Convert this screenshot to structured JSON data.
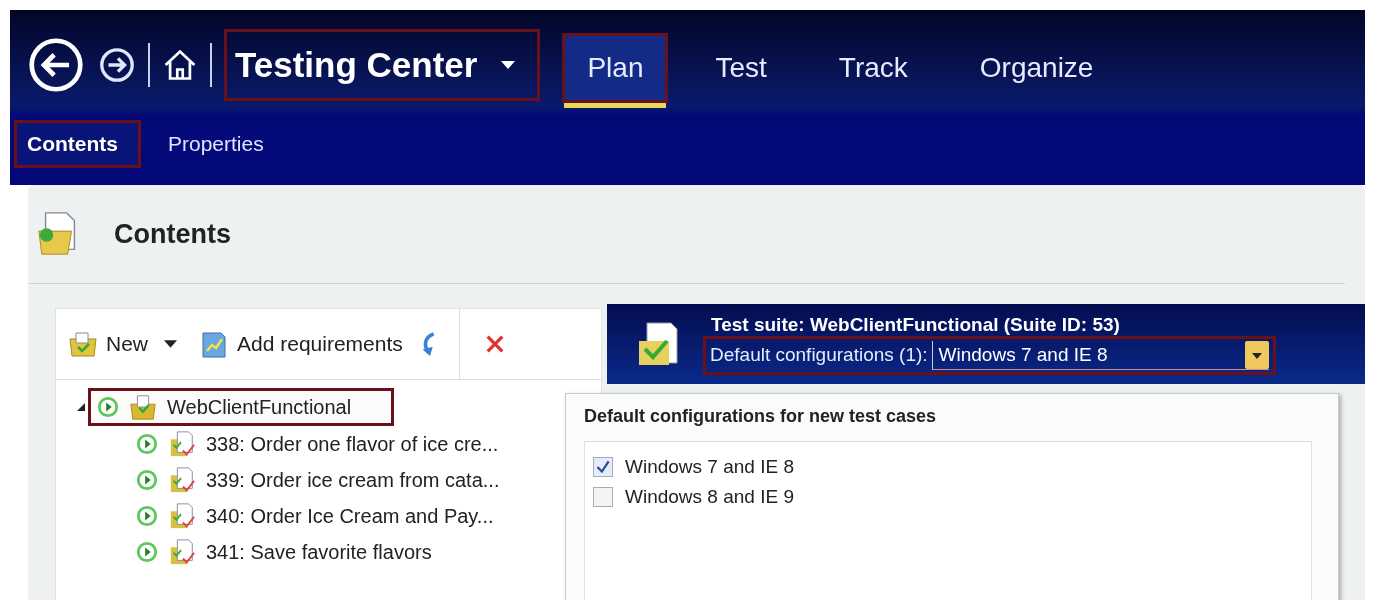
{
  "nav": {
    "title": "Testing Center",
    "highlighted": true
  },
  "hubs": [
    {
      "label": "Plan",
      "selected": true,
      "highlighted": true
    },
    {
      "label": "Test",
      "selected": false,
      "highlighted": false
    },
    {
      "label": "Track",
      "selected": false,
      "highlighted": false
    },
    {
      "label": "Organize",
      "selected": false,
      "highlighted": false
    }
  ],
  "subtabs": [
    {
      "label": "Contents",
      "selected": true,
      "highlighted": true
    },
    {
      "label": "Properties",
      "selected": false,
      "highlighted": false
    }
  ],
  "panel": {
    "title": "Contents"
  },
  "toolbar": {
    "new_label": "New",
    "add_label": "Add requirements"
  },
  "tree": [
    {
      "label": "WebClientFunctional",
      "expanded": true,
      "highlighted": true,
      "children": [
        {
          "label": "338: Order one flavor of ice cre..."
        },
        {
          "label": "339: Order ice cream from cata..."
        },
        {
          "label": "340: Order Ice Cream and Pay..."
        },
        {
          "label": "341: Save favorite flavors"
        }
      ]
    }
  ],
  "suite": {
    "title": "Test suite: WebClientFunctional (Suite ID: 53)",
    "config_label": "Default configurations (1):",
    "config_value": "Windows 7 and IE 8",
    "highlighted": true
  },
  "config_popup": {
    "heading": "Default configurations for new test cases",
    "options": [
      {
        "label": "Windows 7 and IE 8",
        "checked": true
      },
      {
        "label": "Windows 8 and IE 9",
        "checked": false
      }
    ]
  }
}
